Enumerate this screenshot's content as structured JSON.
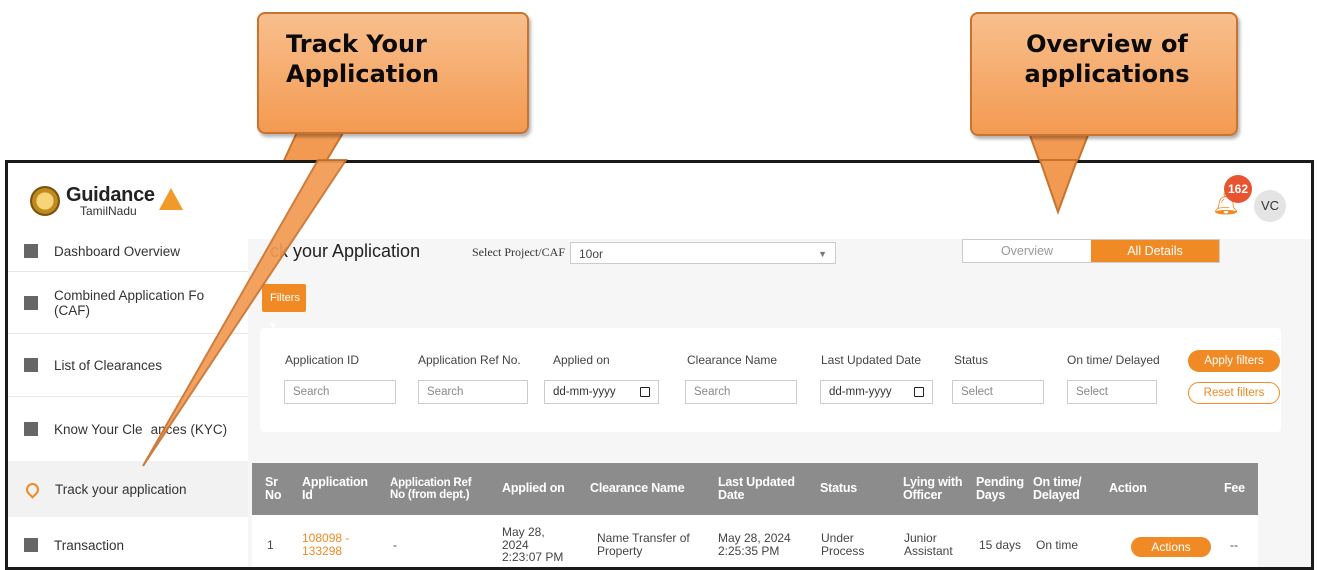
{
  "callouts": {
    "track": [
      "Track Your",
      "Application"
    ],
    "overview": [
      "Overview of",
      "applications"
    ]
  },
  "header": {
    "logo_main": "Guidance",
    "logo_sub": "TamilNadu",
    "notification_count": "162",
    "avatar": "VC"
  },
  "sidebar": {
    "items": [
      {
        "label": "Dashboard Overview",
        "icon": "dashboard-icon"
      },
      {
        "label": "Combined Application Fo",
        "label2": "(CAF)",
        "icon": "document-icon"
      },
      {
        "label": "List of Clearances",
        "icon": "list-icon"
      },
      {
        "label": "Know Your Cle",
        "label_b": "ances (KYC)",
        "icon": "book-icon"
      },
      {
        "label": "Track your application",
        "icon": "location-icon",
        "active": true
      },
      {
        "label": "Transaction",
        "icon": "transaction-icon"
      }
    ]
  },
  "main": {
    "title": "ck your Application",
    "select_label": "Select Project/CAF",
    "select_value": "10or",
    "tabs": [
      "Overview",
      "All Details"
    ],
    "active_tab": "All Details",
    "filters_label": "Filters"
  },
  "filters": {
    "labels": [
      "Application ID",
      "Application Ref No.",
      "Applied on",
      "Clearance Name",
      "Last Updated Date",
      "Status",
      "On time/ Delayed"
    ],
    "inputs": [
      "Search",
      "Search",
      "dd-mm-yyyy",
      "Search",
      "dd-mm-yyyy",
      "Select",
      "Select"
    ],
    "apply": "Apply filters",
    "reset": "Reset filters"
  },
  "table": {
    "headers": [
      [
        "Sr",
        "No"
      ],
      [
        "Application",
        "Id"
      ],
      [
        "Application Ref",
        "No (from dept.)"
      ],
      [
        "Applied on"
      ],
      [
        "Clearance Name"
      ],
      [
        "Last Updated",
        "Date"
      ],
      [
        "Status"
      ],
      [
        "Lying with",
        "Officer"
      ],
      [
        "Pending",
        "Days"
      ],
      [
        "On time/",
        "Delayed"
      ],
      [
        "Action"
      ],
      [
        "Fee"
      ]
    ],
    "rows": [
      {
        "sr": "1",
        "app_id": [
          "108098 -",
          "133298"
        ],
        "ref_no": "-",
        "applied_on": [
          "May 28,",
          "2024",
          "2:23:07 PM"
        ],
        "clearance": [
          "Name Transfer of",
          "Property"
        ],
        "updated": [
          "May 28, 2024",
          "2:25:35 PM"
        ],
        "status": [
          "Under",
          "Process"
        ],
        "officer": [
          "Junior",
          "Assistant"
        ],
        "pending": "15 days",
        "ontime": "On time",
        "action": "Actions",
        "fee": "--"
      }
    ]
  },
  "colors": {
    "accent": "#f08a24",
    "table_header": "#8c8c8c",
    "callout": "#f39a52"
  }
}
